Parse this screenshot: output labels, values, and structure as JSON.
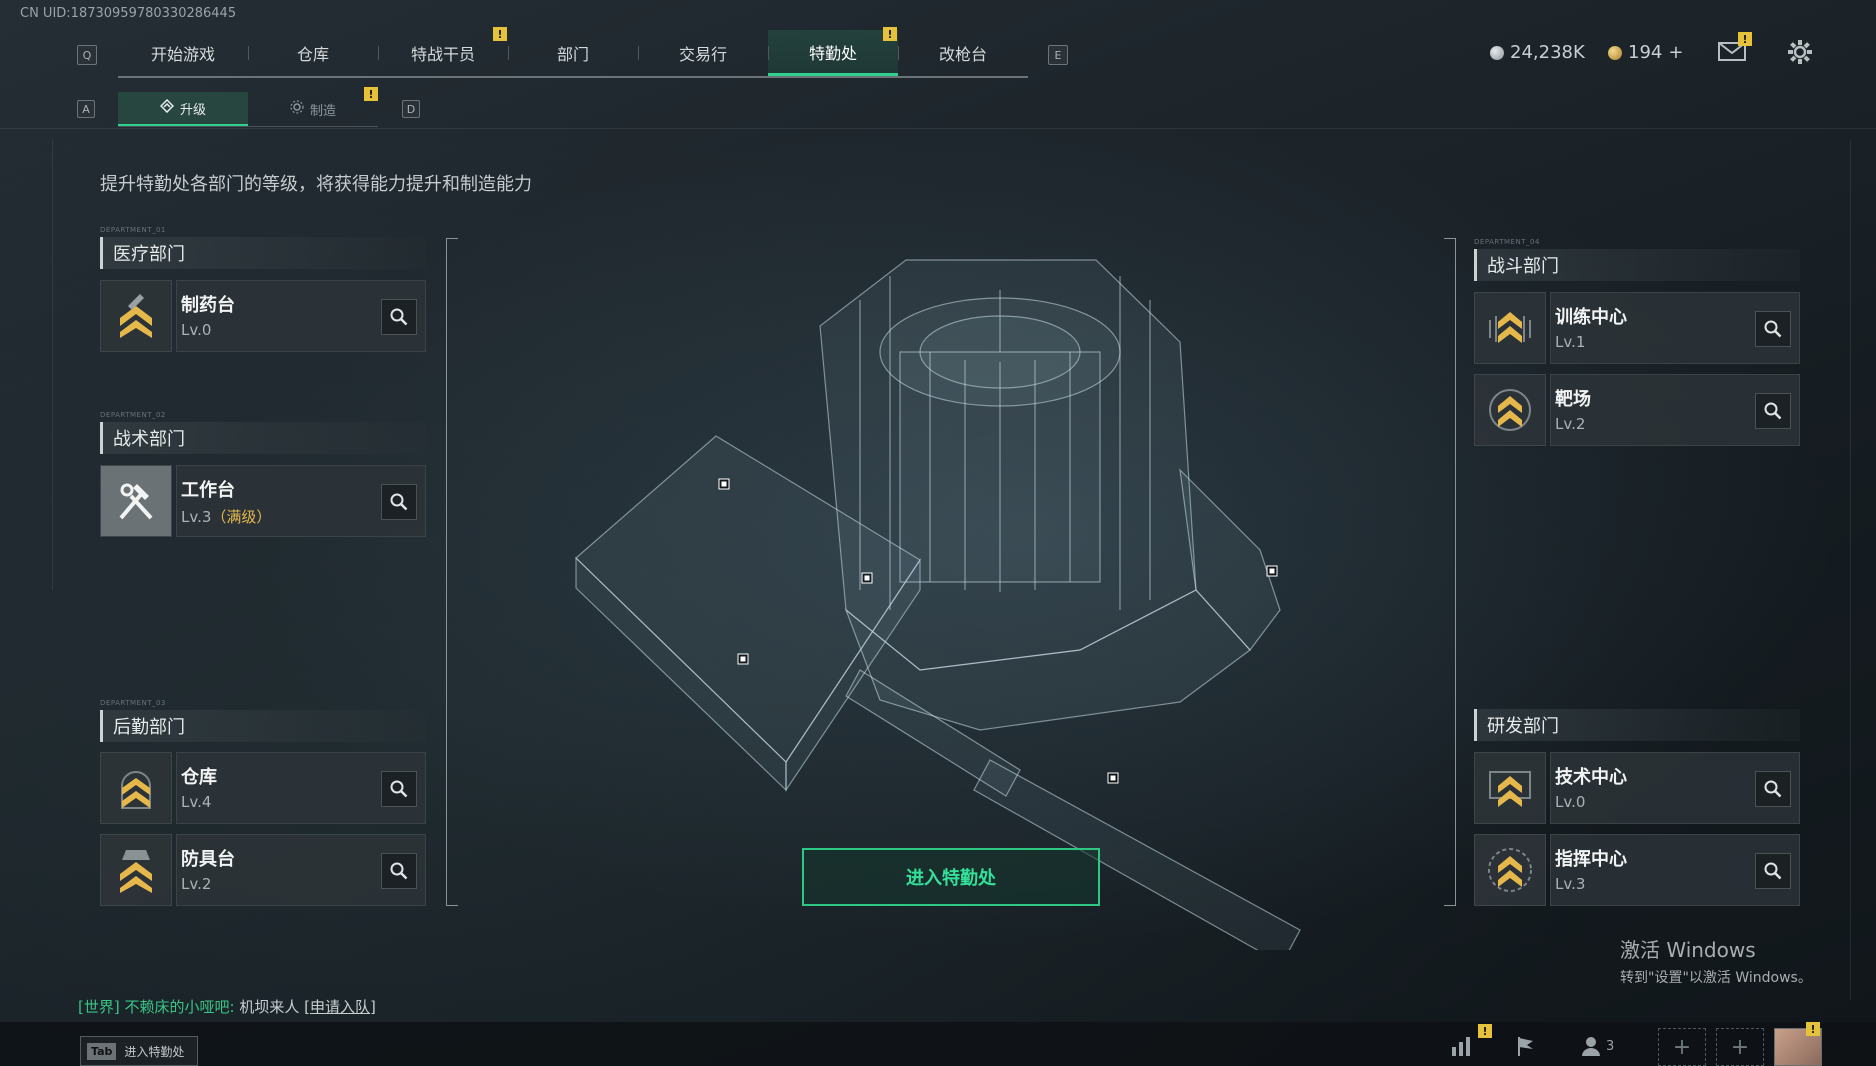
{
  "uid": "CN UID:18730959780330286445",
  "nav": {
    "key_left": "Q",
    "key_right": "E",
    "tabs": [
      {
        "label": "开始游戏"
      },
      {
        "label": "仓库"
      },
      {
        "label": "特战干员",
        "alert": "!"
      },
      {
        "label": "部门"
      },
      {
        "label": "交易行"
      },
      {
        "label": "特勤处",
        "alert": "!",
        "active": true
      },
      {
        "label": "改枪台"
      }
    ]
  },
  "currency": {
    "silver": "24,238K",
    "gold": "194",
    "gold_add": "+"
  },
  "mail_alert": "!",
  "subtabs": {
    "key_left": "A",
    "key_right": "D",
    "upgrade": "升级",
    "craft": "制造",
    "craft_alert": "!"
  },
  "description": "提升特勤处各部门的等级，将获得能力提升和制造能力",
  "departments": {
    "medical": {
      "tag": "DEPARTMENT_01",
      "title": "医疗部门",
      "facilities": [
        {
          "name": "制药台",
          "level": "Lv.0"
        }
      ]
    },
    "tactical": {
      "tag": "DEPARTMENT_02",
      "title": "战术部门",
      "facilities": [
        {
          "name": "工作台",
          "level": "Lv.3",
          "max": "（满级）"
        }
      ]
    },
    "logistics": {
      "tag": "DEPARTMENT_03",
      "title": "后勤部门",
      "facilities": [
        {
          "name": "仓库",
          "level": "Lv.4"
        },
        {
          "name": "防具台",
          "level": "Lv.2"
        }
      ]
    },
    "combat": {
      "tag": "DEPARTMENT_04",
      "title": "战斗部门",
      "facilities": [
        {
          "name": "训练中心",
          "level": "Lv.1"
        },
        {
          "name": "靶场",
          "level": "Lv.2"
        }
      ]
    },
    "research": {
      "title": "研发部门",
      "facilities": [
        {
          "name": "技术中心",
          "level": "Lv.0"
        },
        {
          "name": "指挥中心",
          "level": "Lv.3"
        }
      ]
    }
  },
  "enter_button": "进入特勤处",
  "chat": {
    "channel": "[世界]",
    "sender": "不赖床的小哑吧:",
    "message": "机坝来人",
    "action": "[申请入队]"
  },
  "bottom": {
    "tab_key": "Tab",
    "tab_label": "进入特勤处",
    "team_count": "3",
    "stats_alert": "!",
    "avatar_alert": "!"
  },
  "watermark": {
    "line1": "激活 Windows",
    "line2": "转到\"设置\"以激活 Windows。"
  },
  "colors": {
    "accent": "#2fd08e",
    "alert": "#e6c13a",
    "max_level": "#e6b84c"
  }
}
